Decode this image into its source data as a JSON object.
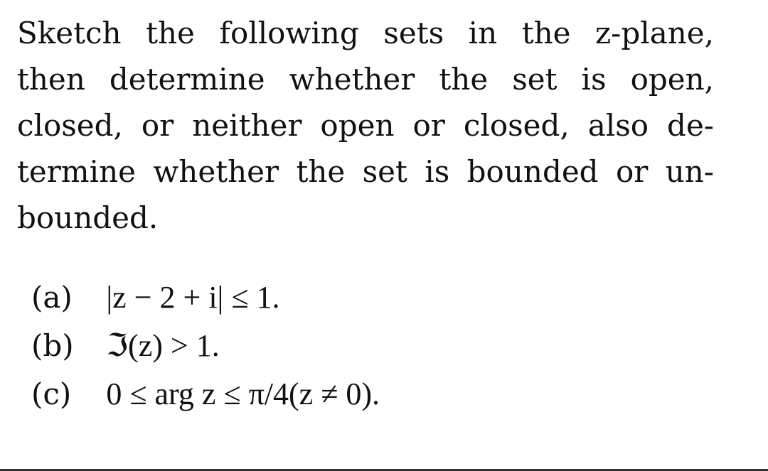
{
  "problem": {
    "lines": [
      "Sketch the following sets in the z-plane,",
      "then determine whether the set is open,",
      "closed, or neither open or closed, also de-",
      "termine whether the set is bounded or un-",
      "bounded."
    ],
    "items": [
      {
        "label": "(a)",
        "expr": "|z − 2 + i| ≤ 1."
      },
      {
        "label": "(b)",
        "expr": "ℑ(z) > 1."
      },
      {
        "label": "(c)",
        "expr": "0 ≤ arg z ≤ π/4(z ≠ 0)."
      }
    ]
  }
}
